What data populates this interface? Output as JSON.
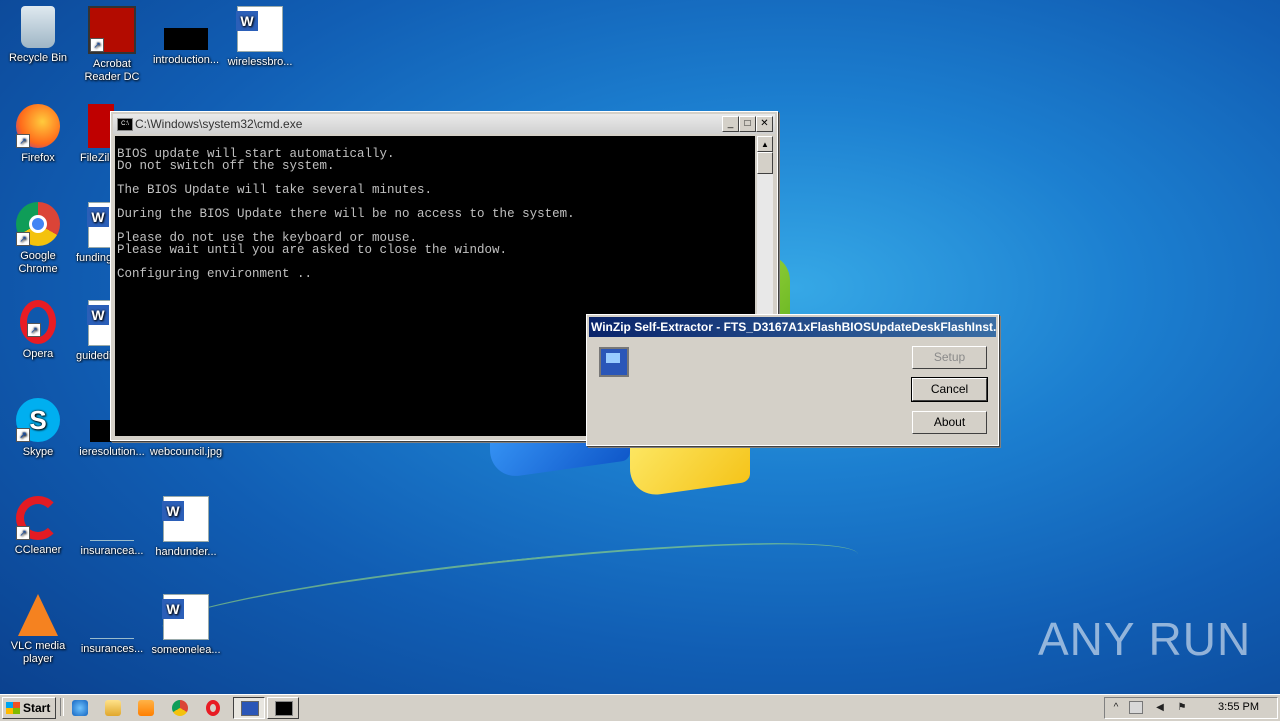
{
  "desktop": {
    "icons": [
      {
        "label": "Recycle Bin",
        "icon": "recycle-bin-icon"
      },
      {
        "label": "Acrobat Reader DC",
        "icon": "acrobat-reader-icon"
      },
      {
        "label": "introduction...",
        "icon": "image-file-icon"
      },
      {
        "label": "wirelessbro...",
        "icon": "word-document-icon"
      },
      {
        "label": "Firefox",
        "icon": "firefox-icon"
      },
      {
        "label": "FileZilla",
        "icon": "filezilla-icon"
      },
      {
        "label": "Google Chrome",
        "icon": "chrome-icon"
      },
      {
        "label": "funding",
        "icon": "word-document-icon"
      },
      {
        "label": "Opera",
        "icon": "opera-icon"
      },
      {
        "label": "guidedi",
        "icon": "word-document-icon"
      },
      {
        "label": "Skype",
        "icon": "skype-icon"
      },
      {
        "label": "ieresolution...",
        "icon": "image-file-icon"
      },
      {
        "label": "webcouncil.jpg",
        "icon": "image-file-icon"
      },
      {
        "label": "CCleaner",
        "icon": "ccleaner-icon"
      },
      {
        "label": "insurancea...",
        "icon": "blank-file-icon"
      },
      {
        "label": "handunder...",
        "icon": "word-document-icon"
      },
      {
        "label": "VLC media player",
        "icon": "vlc-icon"
      },
      {
        "label": "insurances...",
        "icon": "blank-file-icon"
      },
      {
        "label": "someonelea...",
        "icon": "word-document-icon"
      }
    ]
  },
  "cmd_window": {
    "title": "C:\\Windows\\system32\\cmd.exe",
    "lines": [
      "BIOS update will start automatically.",
      "Do not switch off the system.",
      "",
      "The BIOS Update will take several minutes.",
      "",
      "During the BIOS Update there will be no access to the system.",
      "",
      "Please do not use the keyboard or mouse.",
      "Please wait until you are asked to close the window.",
      "",
      "Configuring environment .."
    ],
    "minimize_glyph": "_",
    "maximize_glyph": "□",
    "close_glyph": "✕"
  },
  "winzip_dialog": {
    "title": "WinZip Self-Extractor - FTS_D3167A1xFlashBIOSUpdateDeskFlashInst...",
    "setup_label": "Setup",
    "cancel_label": "Cancel",
    "about_label": "About"
  },
  "watermark": "ANY RUN",
  "taskbar": {
    "start_label": "Start",
    "clock": "3:55 PM",
    "tray_expand_glyph": "^"
  },
  "colors": {
    "desktop_blue": "#1c7fd0",
    "winzip_title": "#0a246a",
    "console_bg": "#000000"
  }
}
